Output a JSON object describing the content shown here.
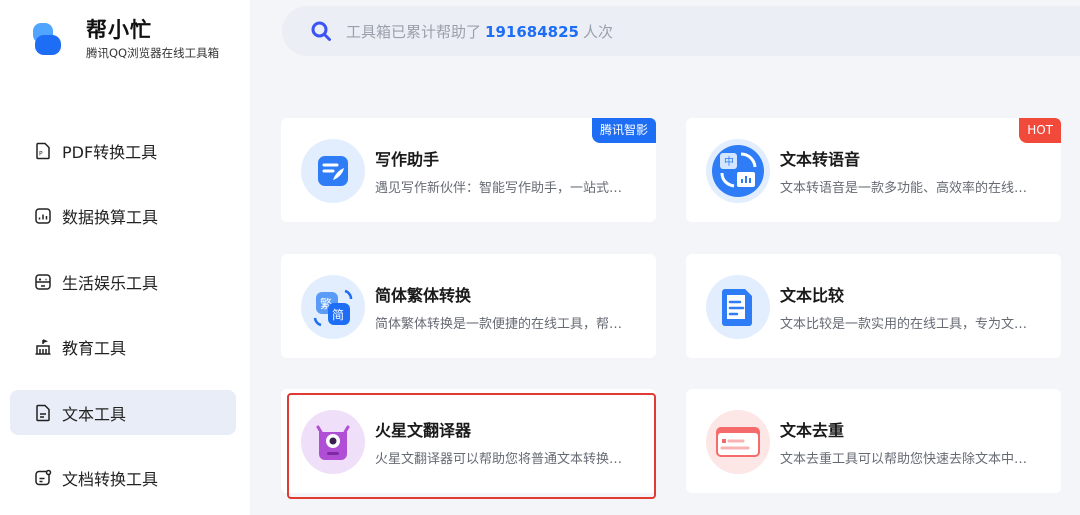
{
  "brand": {
    "name": "帮小忙",
    "subtitle": "腾讯QQ浏览器在线工具箱"
  },
  "search": {
    "prefix": "工具箱已累计帮助了",
    "count": "191684825",
    "suffix": "人次"
  },
  "sidebar": {
    "items": [
      {
        "label": "PDF转换工具",
        "icon": "pdf-icon",
        "active": false
      },
      {
        "label": "数据换算工具",
        "icon": "data-chart-icon",
        "active": false
      },
      {
        "label": "生活娱乐工具",
        "icon": "gamepad-icon",
        "active": false
      },
      {
        "label": "教育工具",
        "icon": "school-icon",
        "active": false
      },
      {
        "label": "文本工具",
        "icon": "text-doc-icon",
        "active": true
      },
      {
        "label": "文档转换工具",
        "icon": "doc-convert-icon",
        "active": false
      }
    ]
  },
  "cards": [
    {
      "title": "写作助手",
      "desc": "遇见写作新伙伴：智能写作助手，一站式提升写作效率",
      "badge": "腾讯智影",
      "icon": "pen-note-icon"
    },
    {
      "title": "文本转语音",
      "desc": "文本转语音是一款多功能、高效率的在线工具",
      "badge": "HOT",
      "icon": "text-to-speech-icon"
    },
    {
      "title": "简体繁体转换",
      "desc": "简体繁体转换是一款便捷的在线工具，帮助您快速转换",
      "icon": "traditional-simplified-icon"
    },
    {
      "title": "文本比较",
      "desc": "文本比较是一款实用的在线工具，专为文本差异对比设计",
      "icon": "document-compare-icon"
    },
    {
      "title": "火星文翻译器",
      "desc": "火星文翻译器可以帮助您将普通文本转换为火星文",
      "icon": "monster-translator-icon"
    },
    {
      "title": "文本去重",
      "desc": "文本去重工具可以帮助您快速去除文本中的重复内容",
      "icon": "deduplicate-icon"
    }
  ],
  "colors": {
    "accent": "#1d6df5",
    "hot": "#f24a3a",
    "highlight": "#e03b33"
  }
}
